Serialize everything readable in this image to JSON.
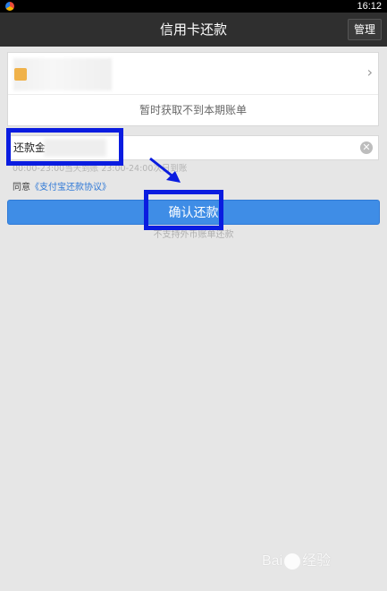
{
  "status_bar": {
    "time": "16:12"
  },
  "header": {
    "title": "信用卡还款",
    "manage_label": "管理"
  },
  "card_section": {
    "bill_status": "暂时获取不到本期账单",
    "chevron": "›"
  },
  "amount_field": {
    "label": "还款金",
    "clear_symbol": "✕"
  },
  "time_note": "00:00-23:00当天到账 23:00-24:00次日到账",
  "agreement": {
    "prefix": "同意",
    "link_text": "《支付宝还款协议》"
  },
  "confirm_button": {
    "label": "确认还款"
  },
  "footnote": "不支持外币账单还款",
  "watermark": {
    "text_left": "Bai",
    "text_right": "经验"
  },
  "colors": {
    "app_bar": "#2f2f2f",
    "accent_button": "#3f8de6",
    "link": "#2d77d6",
    "annotation": "#0a1ce0"
  }
}
